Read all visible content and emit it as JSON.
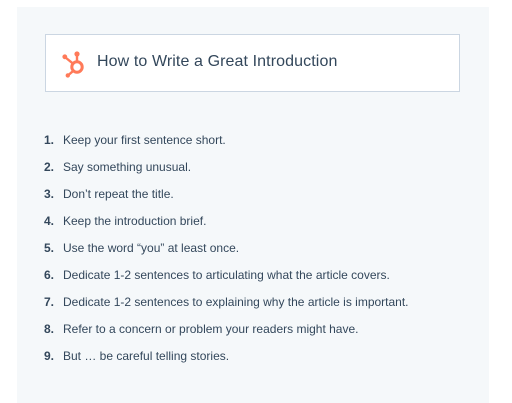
{
  "card": {
    "icon": "hubspot-sprocket-icon",
    "title": "How to Write a Great Introduction",
    "accent_color": "#ff7a59"
  },
  "list": {
    "items": [
      {
        "number": "1.",
        "text": "Keep your first sentence short."
      },
      {
        "number": "2.",
        "text": "Say something unusual."
      },
      {
        "number": "3.",
        "text": "Don’t repeat the title."
      },
      {
        "number": "4.",
        "text": "Keep the introduction brief."
      },
      {
        "number": "5.",
        "text": "Use the word “you” at least once."
      },
      {
        "number": "6.",
        "text": "Dedicate 1-2 sentences to articulating what the article covers."
      },
      {
        "number": "7.",
        "text": "Dedicate 1-2 sentences to explaining why the article is important."
      },
      {
        "number": "8.",
        "text": "Refer to a concern or problem your readers might have."
      },
      {
        "number": "9.",
        "text": "But … be careful telling stories."
      }
    ]
  }
}
